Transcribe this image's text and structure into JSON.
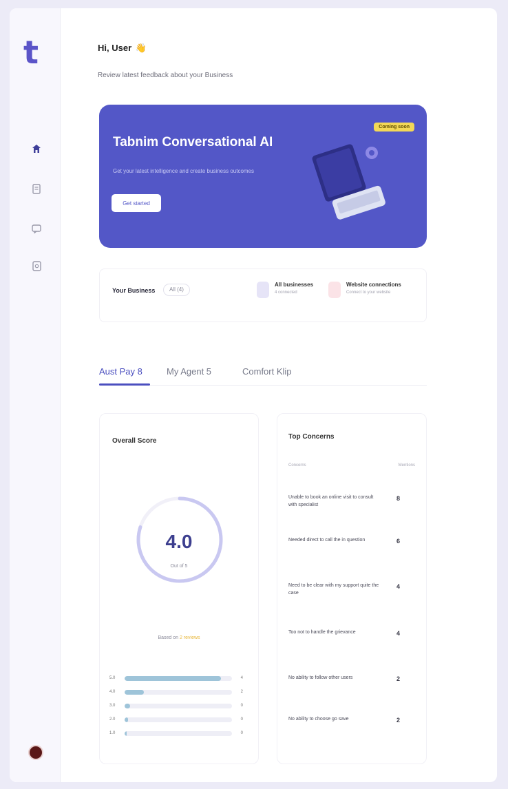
{
  "sidebar": {
    "logo": "t",
    "nav": [
      "home-icon",
      "document-icon",
      "chat-icon",
      "settings-icon"
    ]
  },
  "header": {
    "greeting": "Hi, User",
    "greeting_emoji": "👋",
    "subtitle": "Review latest feedback about your Business"
  },
  "banner": {
    "title": "Tabnim Conversational AI",
    "description": "Get your latest intelligence and create business outcomes",
    "button_label": "Get started",
    "badge": "Coming soon",
    "accent": "#5357c7"
  },
  "business": {
    "label": "Your Business",
    "selector": "All (4)",
    "items": [
      {
        "title": "All businesses",
        "subtitle": "4 connected",
        "color": "#e6e4f7"
      },
      {
        "title": "Website connections",
        "subtitle": "Connect to your website",
        "color": "#fbe3e7"
      }
    ]
  },
  "tabs": [
    {
      "label": "Aust Pay 8",
      "active": true
    },
    {
      "label": "My Agent 5",
      "active": false
    },
    {
      "label": "Comfort Klip",
      "active": false
    }
  ],
  "overall": {
    "title": "Overall Score",
    "score": "4.0",
    "score_caption": "Out of 5",
    "based_on": "Based on",
    "review_count": "2 reviews",
    "ratings": [
      {
        "label": "5.0",
        "fraction": 0.9,
        "count": "4"
      },
      {
        "label": "4.0",
        "fraction": 0.18,
        "count": "2"
      },
      {
        "label": "3.0",
        "fraction": 0.05,
        "count": "0"
      },
      {
        "label": "2.0",
        "fraction": 0.03,
        "count": "0"
      },
      {
        "label": "1.0",
        "fraction": 0.02,
        "count": "0"
      }
    ],
    "gauge_fraction": 0.8,
    "gauge_color": "#c9c8f1"
  },
  "concerns": {
    "title": "Top Concerns",
    "col_left": "Concerns",
    "col_right": "Mentions",
    "items": [
      {
        "text": "Unable to book an online visit to consult with specialist",
        "count": "8"
      },
      {
        "text": "Needed direct to call the in question",
        "count": "6"
      },
      {
        "text": "Need to be clear with my support quite the case",
        "count": "4"
      },
      {
        "text": "Too not to handle the grievance",
        "count": "4"
      },
      {
        "text": "No ability to follow other users",
        "count": "2"
      },
      {
        "text": "No ability to choose go save",
        "count": "2"
      }
    ]
  }
}
